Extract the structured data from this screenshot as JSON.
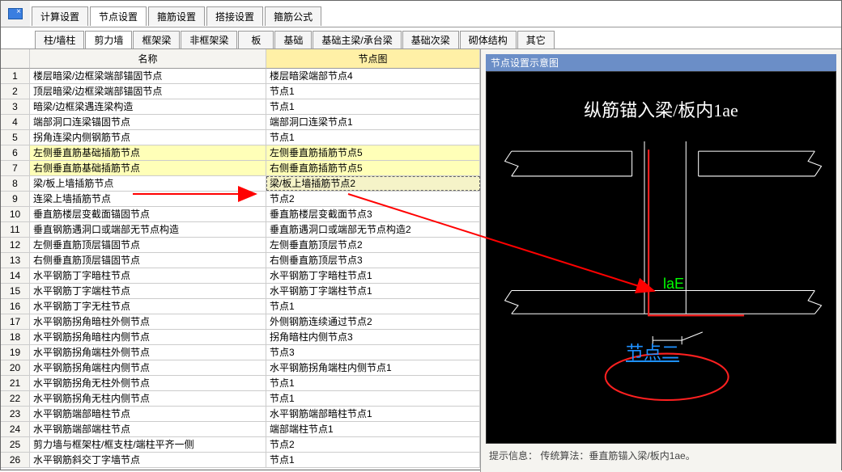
{
  "tabs": {
    "main": [
      {
        "label": "计算设置",
        "active": false
      },
      {
        "label": "节点设置",
        "active": true
      },
      {
        "label": "箍筋设置",
        "active": false
      },
      {
        "label": "搭接设置",
        "active": false
      },
      {
        "label": "箍筋公式",
        "active": false
      }
    ],
    "sub": [
      {
        "label": "柱/墙柱",
        "active": false
      },
      {
        "label": "剪力墙",
        "active": true
      },
      {
        "label": "框架梁",
        "active": false
      },
      {
        "label": "非框架梁",
        "active": false
      },
      {
        "label": "板",
        "active": false
      },
      {
        "label": "基础",
        "active": false
      },
      {
        "label": "基础主梁/承台梁",
        "active": false,
        "wide": true
      },
      {
        "label": "基础次梁",
        "active": false
      },
      {
        "label": "砌体结构",
        "active": false
      },
      {
        "label": "其它",
        "active": false
      }
    ]
  },
  "headers": {
    "name": "名称",
    "node": "节点图"
  },
  "rows": [
    {
      "n": 1,
      "name": "楼层暗梁/边框梁端部锚固节点",
      "node": "楼层暗梁端部节点4"
    },
    {
      "n": 2,
      "name": "顶层暗梁/边框梁端部锚固节点",
      "node": "节点1"
    },
    {
      "n": 3,
      "name": "暗梁/边框梁遇连梁构造",
      "node": "节点1"
    },
    {
      "n": 4,
      "name": "端部洞口连梁锚固节点",
      "node": "端部洞口连梁节点1"
    },
    {
      "n": 5,
      "name": "拐角连梁内侧钢筋节点",
      "node": "节点1"
    },
    {
      "n": 6,
      "name": "左侧垂直筋基础插筋节点",
      "node": "左侧垂直筋插筋节点5",
      "hl": true
    },
    {
      "n": 7,
      "name": "右侧垂直筋基础插筋节点",
      "node": "右侧垂直筋插筋节点5",
      "hl": true
    },
    {
      "n": 8,
      "name": "梁/板上墙插筋节点",
      "node": "梁/板上墙插筋节点2",
      "sel": true
    },
    {
      "n": 9,
      "name": "连梁上墙插筋节点",
      "node": "节点2"
    },
    {
      "n": 10,
      "name": "垂直筋楼层变截面锚固节点",
      "node": "垂直筋楼层变截面节点3"
    },
    {
      "n": 11,
      "name": "垂直钢筋遇洞口或端部无节点构造",
      "node": "垂直筋遇洞口或端部无节点构造2"
    },
    {
      "n": 12,
      "name": "左侧垂直筋顶层锚固节点",
      "node": "左侧垂直筋顶层节点2"
    },
    {
      "n": 13,
      "name": "右侧垂直筋顶层锚固节点",
      "node": "右侧垂直筋顶层节点3"
    },
    {
      "n": 14,
      "name": "水平钢筋丁字暗柱节点",
      "node": "水平钢筋丁字暗柱节点1"
    },
    {
      "n": 15,
      "name": "水平钢筋丁字端柱节点",
      "node": "水平钢筋丁字端柱节点1"
    },
    {
      "n": 16,
      "name": "水平钢筋丁字无柱节点",
      "node": "节点1"
    },
    {
      "n": 17,
      "name": "水平钢筋拐角暗柱外侧节点",
      "node": "外侧钢筋连续通过节点2"
    },
    {
      "n": 18,
      "name": "水平钢筋拐角暗柱内侧节点",
      "node": "拐角暗柱内侧节点3"
    },
    {
      "n": 19,
      "name": "水平钢筋拐角端柱外侧节点",
      "node": "节点3"
    },
    {
      "n": 20,
      "name": "水平钢筋拐角端柱内侧节点",
      "node": "水平钢筋拐角端柱内侧节点1"
    },
    {
      "n": 21,
      "name": "水平钢筋拐角无柱外侧节点",
      "node": "节点1"
    },
    {
      "n": 22,
      "name": "水平钢筋拐角无柱内侧节点",
      "node": "节点1"
    },
    {
      "n": 23,
      "name": "水平钢筋端部暗柱节点",
      "node": "水平钢筋端部暗柱节点1"
    },
    {
      "n": 24,
      "name": "水平钢筋端部端柱节点",
      "node": "端部端柱节点1"
    },
    {
      "n": 25,
      "name": "剪力墙与框架柱/框支柱/端柱平齐一侧",
      "node": "节点2"
    },
    {
      "n": 26,
      "name": "水平钢筋斜交丁字墙节点",
      "node": "节点1"
    }
  ],
  "preview": {
    "title": "节点设置示意图",
    "cad_title": "纵筋锚入梁/板内1ae",
    "lae": "laE",
    "node2": "节点二",
    "info_label": "提示信息：",
    "info_text": "传统算法：垂直筋锚入梁/板内1ae。"
  }
}
